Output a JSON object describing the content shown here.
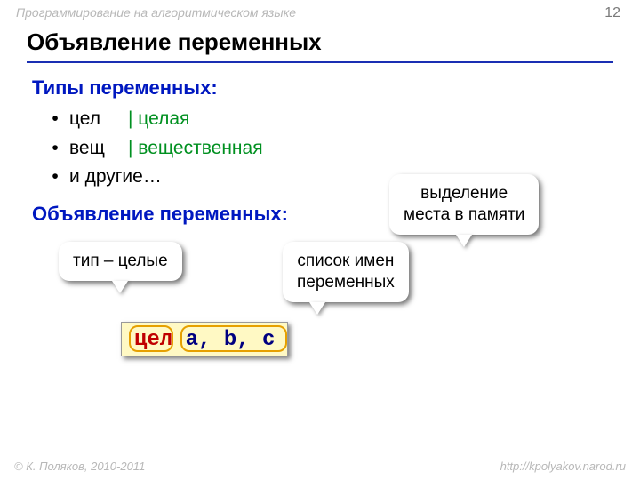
{
  "header": {
    "context": "Программирование на алгоритмическом языке",
    "page": "12",
    "title": "Объявление переменных"
  },
  "sections": {
    "types_heading": "Типы переменных:",
    "bullets": [
      {
        "kw": "цел",
        "comment": "| целая"
      },
      {
        "kw": "вещ",
        "comment": "| вещественная"
      },
      {
        "kw": "и другие…",
        "comment": ""
      }
    ],
    "decl_heading": "Объявление переменных:"
  },
  "callouts": {
    "type": "тип – целые",
    "list_line1": "список имен",
    "list_line2": "переменных",
    "mem_line1": "выделение",
    "mem_line2": "места в памяти"
  },
  "code": {
    "kw": "цел",
    "vars": "a, b, c"
  },
  "footer": {
    "left": "© К. Поляков, 2010-2011",
    "right": "http://kpolyakov.narod.ru"
  }
}
